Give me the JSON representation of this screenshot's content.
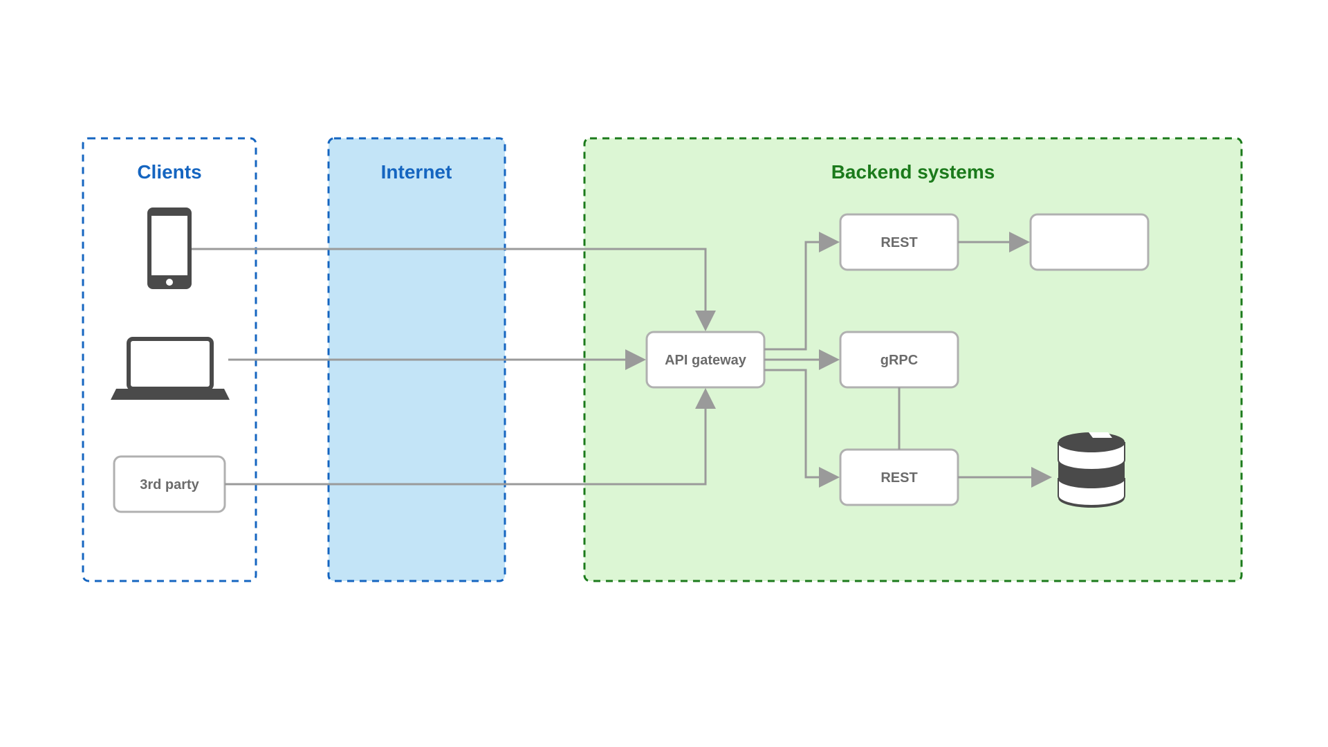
{
  "zones": {
    "clients": {
      "title": "Clients"
    },
    "internet": {
      "title": "Internet"
    },
    "backend": {
      "title": "Backend systems"
    }
  },
  "nodes": {
    "third_party": "3rd party",
    "api_gateway": "API gateway",
    "svc_rest_top": "REST",
    "svc_grpc": "gRPC",
    "svc_rest_bottom": "REST"
  },
  "colors": {
    "blue": "#1565c0",
    "green": "#1b7a1b",
    "lightBlue": "#c3e4f7",
    "lightGreen": "#dcf6d4",
    "gray": "#9a9a9a",
    "iconGray": "#4a4a4a",
    "boxBorder": "#b0b0b0"
  }
}
